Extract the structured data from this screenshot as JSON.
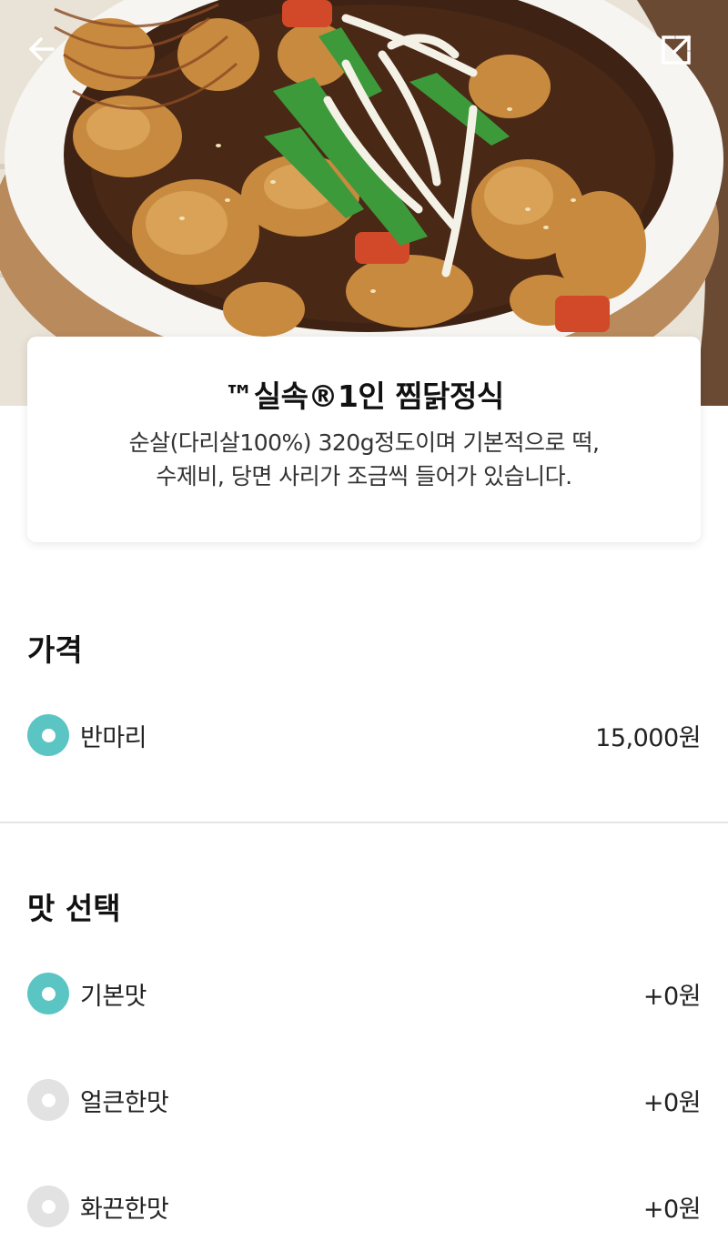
{
  "header": {
    "back_icon": "arrow-left-icon",
    "share_icon": "share-external-icon"
  },
  "item": {
    "title": "™실속®1인 찜닭정식",
    "description_line1": "순살(다리살100%) 320g정도이며 기본적으로 떡,",
    "description_line2": "수제비, 당면 사리가 조금씩 들어가 있습니다."
  },
  "price_section": {
    "title": "가격",
    "options": [
      {
        "label": "반마리",
        "price": "15,000원",
        "selected": true
      }
    ]
  },
  "taste_section": {
    "title": "맛 선택",
    "options": [
      {
        "label": "기본맛",
        "price": "+0원",
        "selected": true
      },
      {
        "label": "얼큰한맛",
        "price": "+0원",
        "selected": false
      },
      {
        "label": "화끈한맛",
        "price": "+0원",
        "selected": false
      }
    ]
  },
  "colors": {
    "accent": "#5bc5c4",
    "radio_off": "#e2e2e2"
  }
}
